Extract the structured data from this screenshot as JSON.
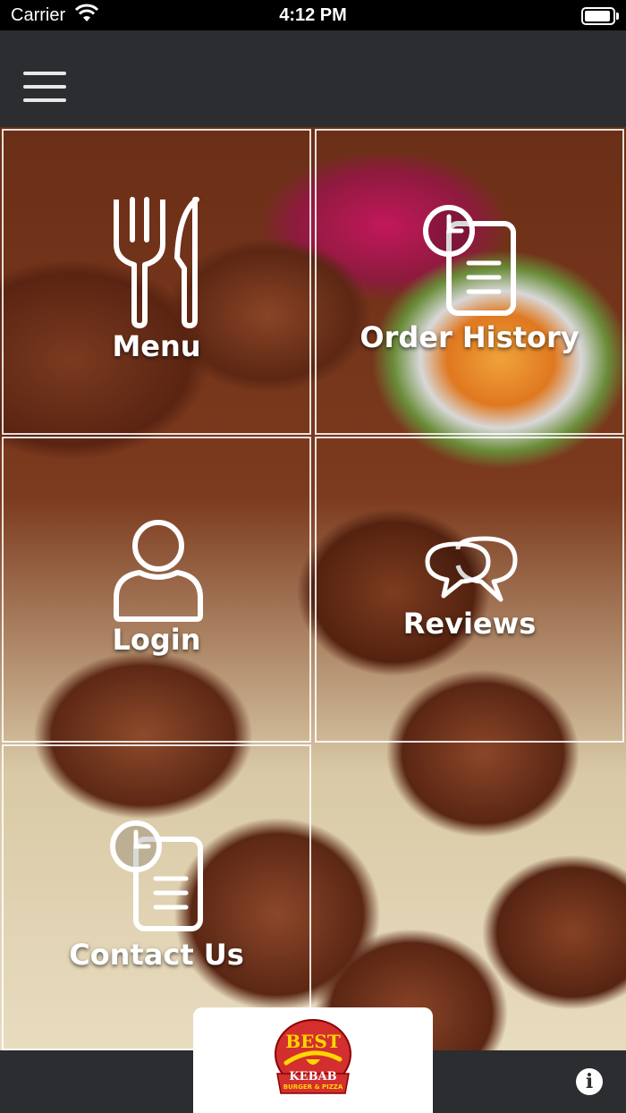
{
  "status_bar": {
    "carrier": "Carrier",
    "time": "4:12 PM",
    "icons": [
      "wifi-icon",
      "battery-icon"
    ]
  },
  "top_bar": {
    "menu_icon": "hamburger-menu-icon"
  },
  "tiles": [
    {
      "label": "Menu",
      "icon": "fork-knife-icon"
    },
    {
      "label": "Order History",
      "icon": "clock-document-icon"
    },
    {
      "label": "Login",
      "icon": "user-icon"
    },
    {
      "label": "Reviews",
      "icon": "chat-bubbles-icon"
    },
    {
      "label": "Contact Us",
      "icon": "clock-document-icon"
    }
  ],
  "logo": {
    "line1": "BEST",
    "line2": "KEBAB",
    "line3": "BURGER & PIZZA",
    "colors": {
      "red": "#d32f2f",
      "yellow": "#ffd700"
    }
  },
  "bottom_bar": {
    "info_icon": "info-icon",
    "info_glyph": "i"
  },
  "colors": {
    "bar_background": "#2b2d30",
    "tile_border": "#ffffff",
    "label_text": "#ffffff"
  }
}
